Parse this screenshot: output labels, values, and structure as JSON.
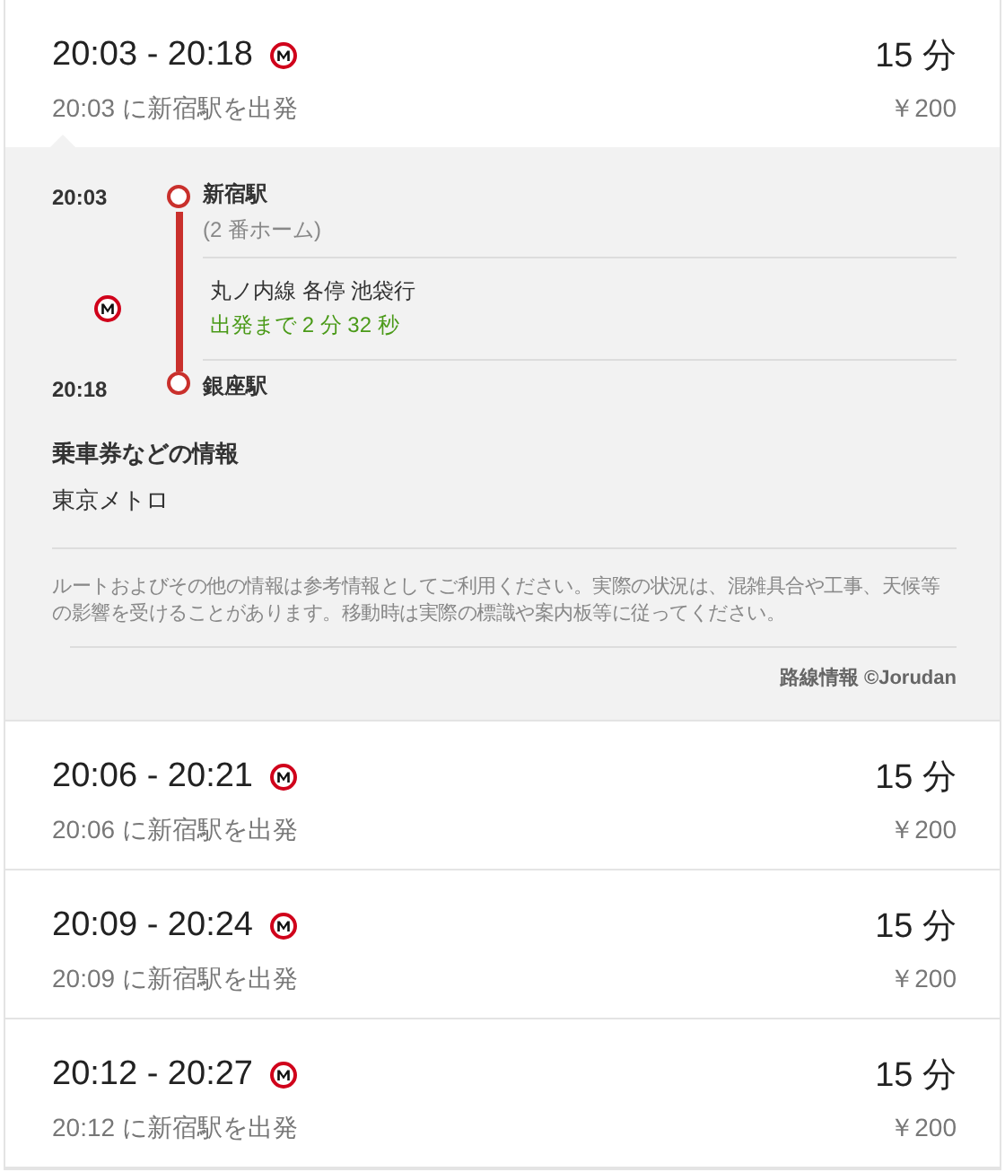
{
  "routes": [
    {
      "time_range": "20:03 - 20:18",
      "duration": "15 分",
      "departure": "20:03 に新宿駅を出発",
      "fare": "￥200",
      "expanded": true,
      "details": {
        "origin": {
          "time": "20:03",
          "station": "新宿駅",
          "platform": "(2 番ホーム)"
        },
        "leg": {
          "line": "丸ノ内線 各停 池袋行",
          "countdown": "出発まで 2 分 32 秒"
        },
        "destination": {
          "time": "20:18",
          "station": "銀座駅"
        },
        "ticket_heading": "乗車券などの情報",
        "operator": "東京メトロ",
        "disclaimer": "ルートおよびその他の情報は参考情報としてご利用ください。実際の状況は、混雑具合や工事、天候等の影響を受けることがあります。移動時は実際の標識や案内板等に従ってください。",
        "credit": "路線情報 ©Jorudan"
      }
    },
    {
      "time_range": "20:06 - 20:21",
      "duration": "15 分",
      "departure": "20:06 に新宿駅を出発",
      "fare": "￥200",
      "expanded": false
    },
    {
      "time_range": "20:09 - 20:24",
      "duration": "15 分",
      "departure": "20:09 に新宿駅を出発",
      "fare": "￥200",
      "expanded": false
    },
    {
      "time_range": "20:12 - 20:27",
      "duration": "15 分",
      "departure": "20:12 に新宿駅を出発",
      "fare": "￥200",
      "expanded": false
    }
  ]
}
